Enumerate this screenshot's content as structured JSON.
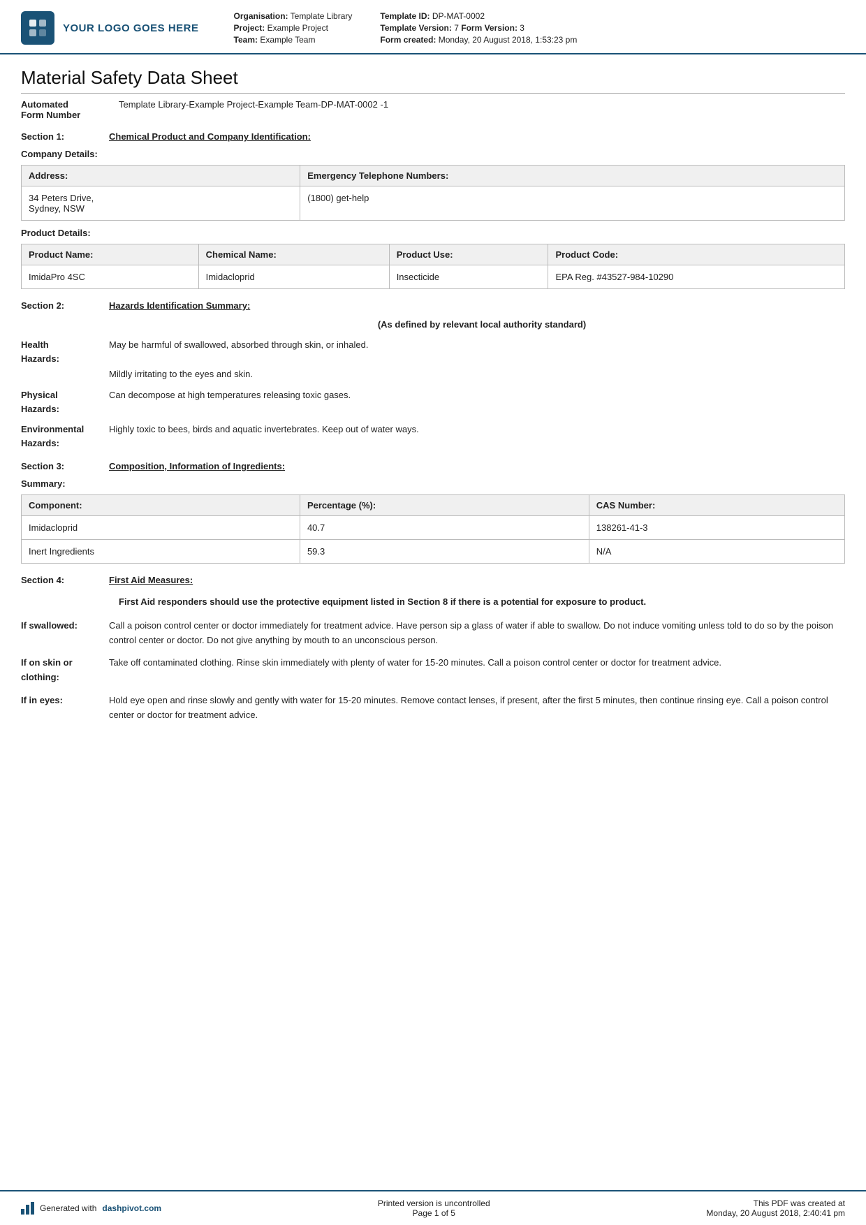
{
  "header": {
    "logo_text": "YOUR LOGO GOES HERE",
    "org_label": "Organisation:",
    "org_value": "Template Library",
    "project_label": "Project:",
    "project_value": "Example Project",
    "team_label": "Team:",
    "team_value": "Example Team",
    "template_id_label": "Template ID:",
    "template_id_value": "DP-MAT-0002",
    "template_version_label": "Template Version:",
    "template_version_value": "7",
    "form_version_label": "Form Version:",
    "form_version_value": "3",
    "form_created_label": "Form created:",
    "form_created_value": "Monday, 20 August 2018, 1:53:23 pm"
  },
  "document": {
    "title": "Material Safety Data Sheet",
    "form_number_label": "Automated\nForm Number",
    "form_number_value": "Template Library-Example Project-Example Team-DP-MAT-0002   -1"
  },
  "section1": {
    "label": "Section 1:",
    "title": "Chemical Product and Company Identification:",
    "company_details_title": "Company Details:",
    "company_table": {
      "headers": [
        "Address:",
        "Emergency Telephone Numbers:"
      ],
      "rows": [
        [
          "34 Peters Drive,\nSydney, NSW",
          "(1800) get-help"
        ]
      ]
    },
    "product_details_title": "Product Details:",
    "product_table": {
      "headers": [
        "Product Name:",
        "Chemical Name:",
        "Product Use:",
        "Product Code:"
      ],
      "rows": [
        [
          "ImidaPro 4SC",
          "Imidacloprid",
          "Insecticide",
          "EPA Reg. #43527-984-10290"
        ]
      ]
    }
  },
  "section2": {
    "label": "Section 2:",
    "title": "Hazards Identification Summary:",
    "note": "(As defined by relevant local authority standard)",
    "hazards": [
      {
        "label": "Health\nHazards:",
        "value": "May be harmful of swallowed, absorbed through skin, or inhaled.\n\nMildly irritating to the eyes and skin."
      },
      {
        "label": "Physical\nHazards:",
        "value": "Can decompose at high temperatures releasing toxic gases."
      },
      {
        "label": "Environmental\nHazards:",
        "value": "Highly toxic to bees, birds and aquatic invertebrates. Keep out of water ways."
      }
    ]
  },
  "section3": {
    "label": "Section 3:",
    "title": "Composition, Information of Ingredients:",
    "summary_title": "Summary:",
    "summary_table": {
      "headers": [
        "Component:",
        "Percentage (%):",
        "CAS Number:"
      ],
      "rows": [
        [
          "Imidacloprid",
          "40.7",
          "138261-41-3"
        ],
        [
          "Inert Ingredients",
          "59.3",
          "N/A"
        ]
      ]
    }
  },
  "section4": {
    "label": "Section 4:",
    "title": "First Aid Measures:",
    "note": "First Aid responders should use the protective equipment listed in Section 8 if there is a potential for exposure to product.",
    "items": [
      {
        "label": "If swallowed:",
        "value": "Call a poison control center or doctor immediately for treatment advice. Have person sip a glass of water if able to swallow. Do not induce vomiting unless told to do so by the poison control center or doctor. Do not give anything by mouth to an unconscious person."
      },
      {
        "label": "If on skin or\nclothing:",
        "value": "Take off contaminated clothing. Rinse skin immediately with plenty of water for 15-20 minutes. Call a poison control center or doctor for treatment advice."
      },
      {
        "label": "If in eyes:",
        "value": "Hold eye open and rinse slowly and gently with water for 15-20 minutes. Remove contact lenses, if present, after the first 5 minutes, then continue rinsing eye. Call a poison control center or doctor for treatment advice."
      }
    ]
  },
  "footer": {
    "generated_text": "Generated with ",
    "dashpivot_link": "dashpivot.com",
    "center_line1": "Printed version is uncontrolled",
    "center_line2": "Page 1 of 5",
    "right_line1": "This PDF was created at",
    "right_line2": "Monday, 20 August 2018, 2:40:41 pm"
  }
}
